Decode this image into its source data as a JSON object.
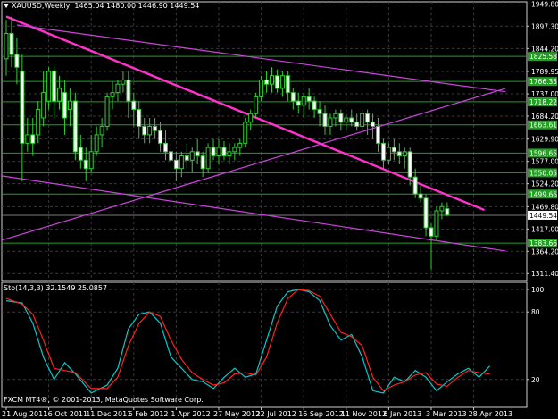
{
  "header": {
    "symbol_title": "XAUUSD,Weekly",
    "ohlc": "1465.04 1480.00 1446.90 1449.54"
  },
  "oscillator": {
    "title": "Sto(14,3,3) 32.1549 25.0857"
  },
  "footer": {
    "copyright": "FXCM MT4®, © 2001-2013, MetaQuotes Software Corp."
  },
  "colors": {
    "background": "#000000",
    "grid": "#3a3a3a",
    "candle": "#32cd32",
    "horizontal_levels": "#22a022",
    "primary_trendline": "#ff33cc",
    "channel_lines": "#cc44dd",
    "stoch_main": "#00cccc",
    "stoch_signal": "#ff2222",
    "price_tag_bg": "#ffffff",
    "price_tag_text": "#000000"
  },
  "chart_data": [
    {
      "type": "candlestick",
      "title": "XAUUSD,Weekly",
      "timeframe": "Weekly",
      "ylim": [
        1295,
        1955
      ],
      "grid": true,
      "price_scale_labels": [
        "1949.80",
        "1897.30",
        "1844.20",
        "1789.95",
        "1737.00",
        "1684.20",
        "1629.90",
        "1577.00",
        "1524.20",
        "1469.80",
        "1417.00",
        "1364.20",
        "1311.40"
      ],
      "highlighted_levels": [
        "1825.58",
        "1766.35",
        "1718.22",
        "1663.61",
        "1596.65",
        "1550.05",
        "1499.66",
        "1449.54",
        "1383.66"
      ],
      "current_price": "1449.54",
      "date_labels": [
        "21 Aug 2011",
        "16 Oct 2011",
        "11 Dec 2011",
        "5 Feb 2012",
        "1 Apr 2012",
        "27 May 2012",
        "22 Jul 2012",
        "16 Sep 2012",
        "11 Nov 2012",
        "6 Jan 2013",
        "3 Mar 2013",
        "28 Apr 2013"
      ],
      "date_label_week_index": [
        0,
        8,
        16,
        24,
        32,
        40,
        48,
        56,
        64,
        72,
        80,
        88
      ],
      "candles_ohlc": [
        [
          1820,
          1912,
          1780,
          1880
        ],
        [
          1880,
          1920,
          1800,
          1830
        ],
        [
          1830,
          1870,
          1760,
          1800
        ],
        [
          1790,
          1830,
          1530,
          1620
        ],
        [
          1620,
          1680,
          1600,
          1640
        ],
        [
          1640,
          1680,
          1590,
          1620
        ],
        [
          1640,
          1720,
          1620,
          1700
        ],
        [
          1680,
          1790,
          1660,
          1740
        ],
        [
          1720,
          1800,
          1700,
          1790
        ],
        [
          1790,
          1802,
          1680,
          1720
        ],
        [
          1720,
          1780,
          1700,
          1750
        ],
        [
          1740,
          1770,
          1640,
          1680
        ],
        [
          1700,
          1750,
          1660,
          1720
        ],
        [
          1720,
          1740,
          1580,
          1600
        ],
        [
          1610,
          1640,
          1560,
          1580
        ],
        [
          1580,
          1610,
          1530,
          1560
        ],
        [
          1560,
          1640,
          1550,
          1600
        ],
        [
          1600,
          1660,
          1590,
          1640
        ],
        [
          1640,
          1680,
          1610,
          1660
        ],
        [
          1660,
          1740,
          1650,
          1730
        ],
        [
          1730,
          1766,
          1700,
          1740
        ],
        [
          1740,
          1770,
          1720,
          1760
        ],
        [
          1760,
          1790,
          1740,
          1770
        ],
        [
          1770,
          1790,
          1680,
          1720
        ],
        [
          1720,
          1740,
          1660,
          1700
        ],
        [
          1700,
          1720,
          1630,
          1660
        ],
        [
          1660,
          1680,
          1620,
          1640
        ],
        [
          1640,
          1680,
          1620,
          1660
        ],
        [
          1660,
          1680,
          1630,
          1650
        ],
        [
          1650,
          1670,
          1600,
          1620
        ],
        [
          1620,
          1650,
          1580,
          1600
        ],
        [
          1600,
          1620,
          1560,
          1580
        ],
        [
          1580,
          1600,
          1530,
          1560
        ],
        [
          1560,
          1600,
          1540,
          1590
        ],
        [
          1590,
          1620,
          1560,
          1580
        ],
        [
          1580,
          1610,
          1550,
          1600
        ],
        [
          1600,
          1630,
          1570,
          1590
        ],
        [
          1590,
          1600,
          1540,
          1560
        ],
        [
          1560,
          1620,
          1550,
          1610
        ],
        [
          1610,
          1630,
          1580,
          1590
        ],
        [
          1590,
          1630,
          1570,
          1610
        ],
        [
          1610,
          1625,
          1580,
          1590
        ],
        [
          1590,
          1620,
          1570,
          1600
        ],
        [
          1600,
          1620,
          1580,
          1610
        ],
        [
          1610,
          1630,
          1590,
          1620
        ],
        [
          1620,
          1680,
          1610,
          1670
        ],
        [
          1670,
          1700,
          1650,
          1690
        ],
        [
          1690,
          1740,
          1680,
          1730
        ],
        [
          1730,
          1780,
          1720,
          1770
        ],
        [
          1770,
          1790,
          1740,
          1760
        ],
        [
          1760,
          1800,
          1740,
          1780
        ],
        [
          1780,
          1795,
          1740,
          1750
        ],
        [
          1750,
          1790,
          1730,
          1780
        ],
        [
          1780,
          1790,
          1720,
          1740
        ],
        [
          1740,
          1750,
          1700,
          1720
        ],
        [
          1720,
          1740,
          1690,
          1710
        ],
        [
          1710,
          1740,
          1680,
          1730
        ],
        [
          1730,
          1750,
          1700,
          1720
        ],
        [
          1720,
          1730,
          1680,
          1700
        ],
        [
          1700,
          1720,
          1660,
          1690
        ],
        [
          1690,
          1710,
          1640,
          1660
        ],
        [
          1660,
          1690,
          1640,
          1680
        ],
        [
          1680,
          1700,
          1660,
          1690
        ],
        [
          1690,
          1700,
          1650,
          1670
        ],
        [
          1670,
          1690,
          1650,
          1680
        ],
        [
          1680,
          1700,
          1660,
          1670
        ],
        [
          1670,
          1690,
          1650,
          1660
        ],
        [
          1660,
          1700,
          1650,
          1690
        ],
        [
          1690,
          1700,
          1640,
          1670
        ],
        [
          1670,
          1690,
          1630,
          1660
        ],
        [
          1660,
          1680,
          1600,
          1620
        ],
        [
          1620,
          1630,
          1560,
          1580
        ],
        [
          1580,
          1620,
          1570,
          1610
        ],
        [
          1610,
          1630,
          1580,
          1600
        ],
        [
          1600,
          1620,
          1570,
          1590
        ],
        [
          1590,
          1610,
          1560,
          1600
        ],
        [
          1600,
          1610,
          1520,
          1540
        ],
        [
          1540,
          1560,
          1490,
          1500
        ],
        [
          1500,
          1520,
          1480,
          1490
        ],
        [
          1490,
          1500,
          1400,
          1420
        ],
        [
          1420,
          1430,
          1321,
          1400
        ],
        [
          1400,
          1470,
          1390,
          1460
        ],
        [
          1460,
          1480,
          1440,
          1470
        ],
        [
          1465,
          1480,
          1447,
          1450
        ]
      ],
      "trendlines": [
        {
          "name": "primary descending trendline",
          "color": "#ff33cc",
          "start_week": 0,
          "start_price": 1920,
          "end_week": 90,
          "end_price": 1462
        },
        {
          "name": "upper channel line",
          "color": "#cc44dd",
          "start_week": 2,
          "start_price": 1900,
          "end_week": 94,
          "end_price": 1742
        },
        {
          "name": "lower channel line",
          "color": "#cc44dd",
          "start_week": -2,
          "start_price": 1545,
          "end_week": 94,
          "end_price": 1365
        },
        {
          "name": "ascending support line",
          "color": "#cc44dd",
          "start_week": -2,
          "start_price": 1386,
          "end_week": 94,
          "end_price": 1750
        }
      ]
    },
    {
      "type": "line",
      "title": "Sto(14,3,3) 32.1549 25.0857",
      "ylim": [
        0,
        100
      ],
      "levels": [
        20,
        80,
        100
      ],
      "level_labels": [
        "100",
        "80",
        "20"
      ],
      "series": [
        {
          "name": "main",
          "color": "#00cccc",
          "points": [
            [
              0,
              90
            ],
            [
              3,
              88
            ],
            [
              5,
              70
            ],
            [
              7,
              40
            ],
            [
              9,
              20
            ],
            [
              11,
              35
            ],
            [
              13,
              25
            ],
            [
              16,
              8
            ],
            [
              19,
              15
            ],
            [
              21,
              30
            ],
            [
              23,
              65
            ],
            [
              25,
              78
            ],
            [
              27,
              80
            ],
            [
              29,
              70
            ],
            [
              31,
              40
            ],
            [
              33,
              30
            ],
            [
              35,
              20
            ],
            [
              37,
              18
            ],
            [
              39,
              12
            ],
            [
              41,
              22
            ],
            [
              43,
              30
            ],
            [
              45,
              22
            ],
            [
              47,
              25
            ],
            [
              49,
              55
            ],
            [
              51,
              85
            ],
            [
              53,
              98
            ],
            [
              55,
              100
            ],
            [
              57,
              98
            ],
            [
              59,
              90
            ],
            [
              61,
              68
            ],
            [
              63,
              55
            ],
            [
              65,
              60
            ],
            [
              67,
              40
            ],
            [
              69,
              10
            ],
            [
              71,
              8
            ],
            [
              73,
              22
            ],
            [
              75,
              18
            ],
            [
              77,
              28
            ],
            [
              79,
              22
            ],
            [
              81,
              10
            ],
            [
              83,
              18
            ],
            [
              85,
              25
            ],
            [
              87,
              30
            ],
            [
              89,
              22
            ],
            [
              91,
              32
            ]
          ]
        },
        {
          "name": "signal",
          "color": "#ff2222",
          "points": [
            [
              0,
              92
            ],
            [
              3,
              87
            ],
            [
              5,
              78
            ],
            [
              7,
              55
            ],
            [
              9,
              30
            ],
            [
              11,
              28
            ],
            [
              13,
              26
            ],
            [
              16,
              12
            ],
            [
              19,
              12
            ],
            [
              21,
              22
            ],
            [
              23,
              50
            ],
            [
              25,
              70
            ],
            [
              27,
              80
            ],
            [
              29,
              76
            ],
            [
              31,
              55
            ],
            [
              33,
              38
            ],
            [
              35,
              26
            ],
            [
              37,
              20
            ],
            [
              39,
              15
            ],
            [
              41,
              17
            ],
            [
              43,
              25
            ],
            [
              45,
              26
            ],
            [
              47,
              24
            ],
            [
              49,
              40
            ],
            [
              51,
              70
            ],
            [
              53,
              92
            ],
            [
              55,
              100
            ],
            [
              57,
              99
            ],
            [
              59,
              94
            ],
            [
              61,
              78
            ],
            [
              63,
              62
            ],
            [
              65,
              58
            ],
            [
              67,
              50
            ],
            [
              69,
              22
            ],
            [
              71,
              10
            ],
            [
              73,
              15
            ],
            [
              75,
              18
            ],
            [
              77,
              24
            ],
            [
              79,
              26
            ],
            [
              81,
              16
            ],
            [
              83,
              14
            ],
            [
              85,
              22
            ],
            [
              87,
              28
            ],
            [
              89,
              26
            ],
            [
              91,
              25
            ]
          ]
        }
      ]
    }
  ]
}
